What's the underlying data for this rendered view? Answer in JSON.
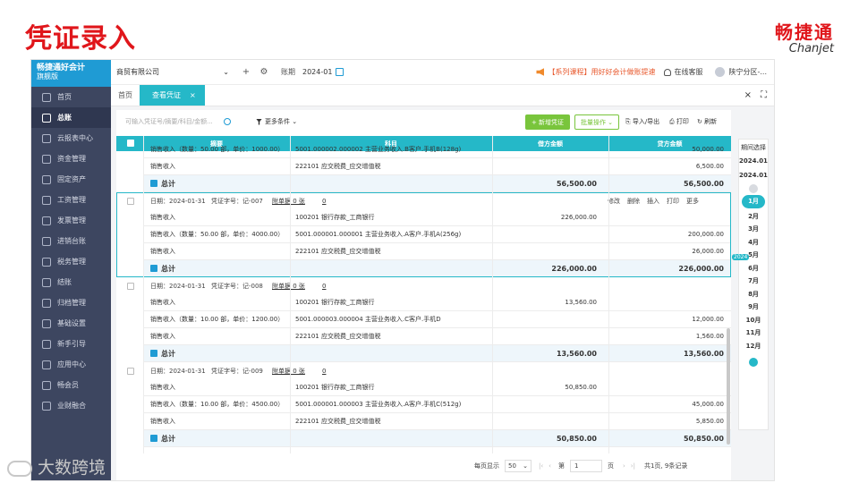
{
  "slide": {
    "title": "凭证录入",
    "brand_cn": "畅捷通",
    "brand_en": "Chanjet",
    "watermark": "大数跨境"
  },
  "app": {
    "logo_name": "畅捷通好会计",
    "logo_sub": "旗舰版",
    "nav": [
      {
        "label": "首页",
        "icon": "home-icon",
        "active": false
      },
      {
        "label": "总账",
        "icon": "ledger-icon",
        "active": true
      },
      {
        "label": "云报表中心",
        "icon": "cloud-report-icon",
        "active": false
      },
      {
        "label": "资金管理",
        "icon": "money-icon",
        "active": false
      },
      {
        "label": "固定资产",
        "icon": "asset-icon",
        "active": false
      },
      {
        "label": "工资管理",
        "icon": "salary-icon",
        "active": false
      },
      {
        "label": "发票管理",
        "icon": "invoice-icon",
        "active": false
      },
      {
        "label": "进销台账",
        "icon": "inventory-icon",
        "active": false
      },
      {
        "label": "税务管理",
        "icon": "tax-icon",
        "active": false
      },
      {
        "label": "结账",
        "icon": "close-books-icon",
        "active": false
      },
      {
        "label": "归档管理",
        "icon": "archive-icon",
        "active": false
      },
      {
        "label": "基础设置",
        "icon": "settings-icon",
        "active": false
      },
      {
        "label": "新手引导",
        "icon": "guide-icon",
        "active": false
      },
      {
        "label": "应用中心",
        "icon": "apps-icon",
        "active": false
      },
      {
        "label": "畅会员",
        "icon": "member-icon",
        "active": false
      },
      {
        "label": "业财融合",
        "icon": "integration-icon",
        "active": false
      }
    ],
    "topbar": {
      "company": "商贸有限公司",
      "period_label": "账期",
      "period_value": "2024-01",
      "notice": "【系列课程】用好好会计做账提速",
      "service": "在线客服",
      "user": "陕宁分区-..."
    },
    "tabs": [
      {
        "label": "首页",
        "active": false
      },
      {
        "label": "查看凭证",
        "active": true
      }
    ],
    "toolbar": {
      "search_placeholder": "可输入凭证号/摘要/科目/金额...",
      "filter": "更多条件",
      "new_btn": "+ 新增凭证",
      "batch_btn": "批量操作",
      "import_export": "导入/导出",
      "print": "打印",
      "refresh": "刷新"
    },
    "grid": {
      "headers": [
        "摘要",
        "科目",
        "借方金额",
        "贷方金额"
      ],
      "partial_rows": [
        {
          "summary": "销售收入（数量：50.00 部，单价：1000.00）",
          "account": "5001.000002.000002 主营业务收入.B客户.手机B(128g)",
          "debit": "",
          "credit": "50,000.00"
        },
        {
          "summary": "销售收入",
          "account": "222101 应交税费_应交增值税",
          "debit": "",
          "credit": "6,500.00"
        }
      ],
      "partial_total": {
        "label": "总计",
        "debit": "56,500.00",
        "credit": "56,500.00"
      },
      "vouchers": [
        {
          "date": "日期：2024-01-31",
          "no": "凭证字号：记-007",
          "attach": "附单据 0 张",
          "link": "0",
          "rows": [
            {
              "summary": "销售收入",
              "account": "100201 银行存款_工商银行",
              "debit": "226,000.00",
              "credit": ""
            },
            {
              "summary": "销售收入（数量：50.00 部，单价：4000.00）",
              "account": "5001.000001.000001 主营业务收入.A客户.手机A(256g)",
              "debit": "",
              "credit": "200,000.00"
            },
            {
              "summary": "销售收入",
              "account": "222101 应交税费_应交增值税",
              "debit": "",
              "credit": "26,000.00"
            }
          ],
          "total": {
            "label": "总计",
            "debit": "226,000.00",
            "credit": "226,000.00"
          }
        },
        {
          "date": "日期：2024-01-31",
          "no": "凭证字号：记-008",
          "attach": "附单据 0 张",
          "link": "0",
          "rows": [
            {
              "summary": "销售收入",
              "account": "100201 银行存款_工商银行",
              "debit": "13,560.00",
              "credit": ""
            },
            {
              "summary": "销售收入（数量：10.00 部，单价：1200.00）",
              "account": "5001.000003.000004 主营业务收入.C客户.手机D",
              "debit": "",
              "credit": "12,000.00"
            },
            {
              "summary": "销售收入",
              "account": "222101 应交税费_应交增值税",
              "debit": "",
              "credit": "1,560.00"
            }
          ],
          "total": {
            "label": "总计",
            "debit": "13,560.00",
            "credit": "13,560.00"
          }
        },
        {
          "date": "日期：2024-01-31",
          "no": "凭证字号：记-009",
          "attach": "附单据 0 张",
          "link": "0",
          "rows": [
            {
              "summary": "销售收入",
              "account": "100201 银行存款_工商银行",
              "debit": "50,850.00",
              "credit": ""
            },
            {
              "summary": "销售收入（数量：10.00 部，单价：4500.00）",
              "account": "5001.000001.000003 主营业务收入.A客户.手机C(512g)",
              "debit": "",
              "credit": "45,000.00"
            },
            {
              "summary": "销售收入",
              "account": "222101 应交税费_应交增值税",
              "debit": "",
              "credit": "5,850.00"
            }
          ],
          "total": {
            "label": "总计",
            "debit": "50,850.00",
            "credit": "50,850.00"
          }
        }
      ],
      "row_ops": [
        "修改",
        "删除",
        "插入",
        "打印",
        "更多"
      ]
    },
    "pager": {
      "per_page_label": "每页显示",
      "per_page": "50",
      "page_prefix": "第",
      "page": "1",
      "page_suffix": "页",
      "summary": "共1页, 9条记录"
    },
    "period_panel": {
      "title": "期间选择",
      "year_top": "2024.01",
      "year_bottom": "2024.01",
      "badge": "2024",
      "months": [
        "1月",
        "2月",
        "3月",
        "4月",
        "5月",
        "6月",
        "7月",
        "8月",
        "9月",
        "10月",
        "11月",
        "12月"
      ],
      "active_month": "1月"
    }
  }
}
